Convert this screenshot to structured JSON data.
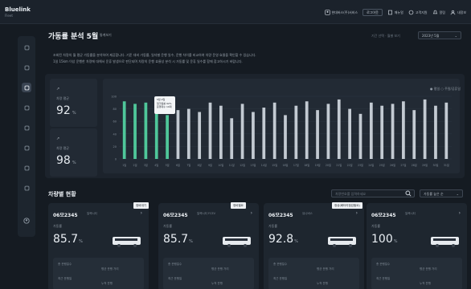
{
  "app": {
    "logo": "Bluelink",
    "logo_sub": "Fleet"
  },
  "topbar": {
    "user_name": "현대버스(주)서비스",
    "btn_logout": "로그아웃",
    "btn_manual": "매뉴얼",
    "btn_support": "고객지원",
    "btn_notice": "알림",
    "btn_mypage": "내정보"
  },
  "page": {
    "title": "가동률 분석 5월",
    "badge": "통계보기",
    "filter_label": "기간 선택 · 월별 보기",
    "filter_value": "2023년 5월",
    "description_1": "조회된 차량의 월 평균 가동률을 분석하여 제공합니다. 기준 대비 가동률, 일자별 운행 일수, 운행 차이를 비교하여 차량 운영 효율을 확인할 수 있습니다.",
    "description_2": "1일 15km 이상 운행한 차량에 대해서 운휴 발생으로 판단되며 차량의 운행 효율성 분석 시 가동률 및 운휴 일수를 함께 참고하시기 바랍니다."
  },
  "stats": [
    {
      "label": "차량 평균",
      "value": "92",
      "unit": "%"
    },
    {
      "label": "차량 평균",
      "value": "98",
      "unit": "%"
    }
  ],
  "chart_legend": "● 평일  ○ 주말/공휴일",
  "tooltip": {
    "line1": "5월 2일",
    "line2": "일가동률 92%",
    "line3": "운행대수 10대"
  },
  "chart_data": {
    "type": "bar",
    "categories": [
      "1일",
      "2일",
      "3일",
      "4일",
      "5일",
      "6일",
      "7일",
      "8일",
      "9일",
      "10일",
      "11일",
      "12일",
      "13일",
      "14일",
      "15일",
      "16일",
      "17일",
      "18일",
      "19일",
      "20일",
      "21일",
      "22일",
      "23일",
      "24일",
      "25일",
      "26일",
      "27일",
      "28일",
      "29일",
      "30일",
      "31일"
    ],
    "values": [
      92,
      88,
      90,
      85,
      70,
      78,
      80,
      75,
      90,
      85,
      65,
      88,
      75,
      82,
      90,
      70,
      85,
      92,
      78,
      88,
      95,
      80,
      72,
      90,
      85,
      88,
      92,
      78,
      95,
      85,
      90
    ],
    "highlight_indices": [
      0,
      1,
      2,
      3,
      4
    ],
    "ylim": [
      0,
      100
    ],
    "yticks": [
      0,
      20,
      40,
      60,
      80,
      100
    ],
    "colors": {
      "highlight": "#4fc79a",
      "normal": "#c3cad2"
    }
  },
  "vehicles": {
    "title": "차량별 현황",
    "search_placeholder": "차량번호를 입력하세요",
    "sort_value": "가동률 높은 순",
    "items": [
      {
        "id": "06모2345",
        "model": "일렉시티",
        "label": "가동률",
        "value": "85.7",
        "unit": "%",
        "tag": "정비대기",
        "r1a": "총 운행일수",
        "r1b": "평균 운행 거리",
        "r2a": "최근 운행일",
        "r2b": "누적 운행"
      },
      {
        "id": "06모2345",
        "model": "일렉시티 FCEV",
        "label": "가동률",
        "value": "85.7",
        "unit": "%",
        "tag": "정비필요",
        "r1a": "총 운행일수",
        "r1b": "평균 운행 거리",
        "r2a": "최근 운행일",
        "r2b": "누적 운행"
      },
      {
        "id": "06모2345",
        "model": "유니버스",
        "label": "가동률",
        "value": "92.8",
        "unit": "%",
        "tag": "정상(배터리점검필요)",
        "r1a": "총 운행일수",
        "r1b": "평균 운행 거리",
        "r2a": "최근 운행일",
        "r2b": "누적 운행"
      },
      {
        "id": "06모2345",
        "model": "일렉시티",
        "label": "가동률",
        "value": "100",
        "unit": "%",
        "tag": "",
        "r1a": "총 운행일수",
        "r1b": "평균 운행 거리",
        "r2a": "최근 운행일",
        "r2b": "누적 운행"
      }
    ]
  },
  "sidebar": {
    "icons": [
      "home-icon",
      "dashboard-icon",
      "analytics-icon",
      "location-icon",
      "trip-icon",
      "list-icon",
      "report-icon",
      "settings-icon"
    ],
    "active_index": 2,
    "bottom_icon": "user-icon"
  }
}
